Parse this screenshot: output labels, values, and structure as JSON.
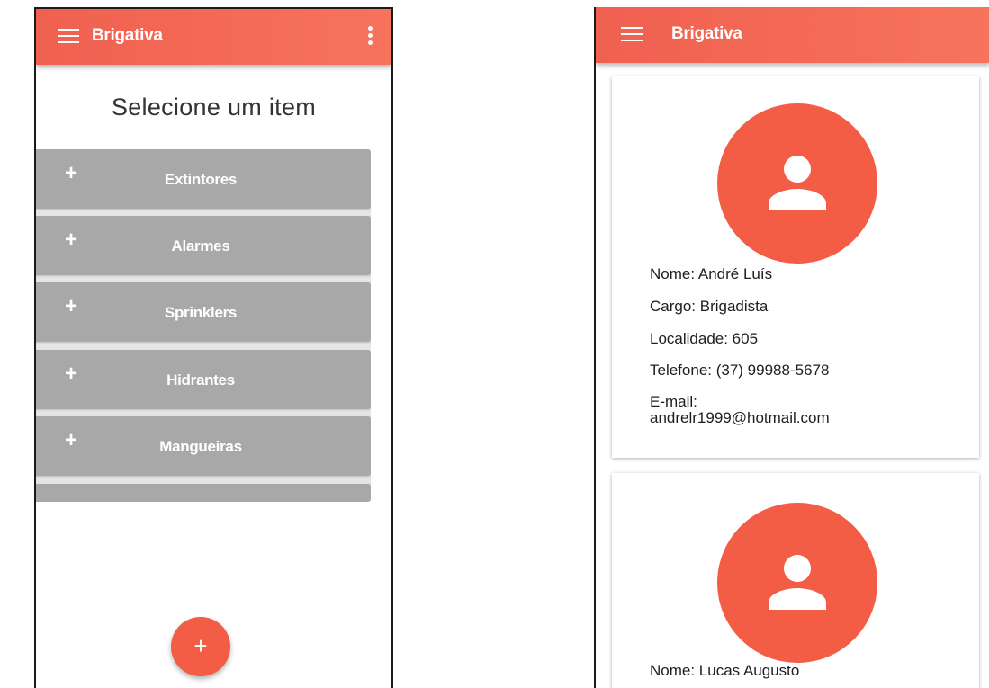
{
  "colors": {
    "accent": "#f35c45",
    "appbar": "#f26a55",
    "list_item": "#a8a8a8"
  },
  "left_screen": {
    "appbar": {
      "title": "Brigativa",
      "menu_icon": "hamburger-menu-icon",
      "overflow_icon": "more-vertical-icon"
    },
    "heading": "Selecione um item",
    "items": [
      {
        "icon": "+",
        "label": "Extintores"
      },
      {
        "icon": "+",
        "label": "Alarmes"
      },
      {
        "icon": "+",
        "label": "Sprinklers"
      },
      {
        "icon": "+",
        "label": "Hidrantes"
      },
      {
        "icon": "+",
        "label": "Mangueiras"
      }
    ],
    "fab": {
      "icon": "+"
    }
  },
  "right_screen": {
    "appbar": {
      "title": "Brigativa",
      "menu_icon": "hamburger-menu-icon"
    },
    "cards": [
      {
        "avatar_icon": "person-icon",
        "name": "Nome: André Luís",
        "role": "Cargo: Brigadista",
        "location": "Localidade: 605",
        "phone": "Telefone: (37) 99988-5678",
        "email": "E-mail:\nandrelr1999@hotmail.com"
      },
      {
        "avatar_icon": "person-icon",
        "name": "Nome: Lucas Augusto"
      }
    ]
  }
}
